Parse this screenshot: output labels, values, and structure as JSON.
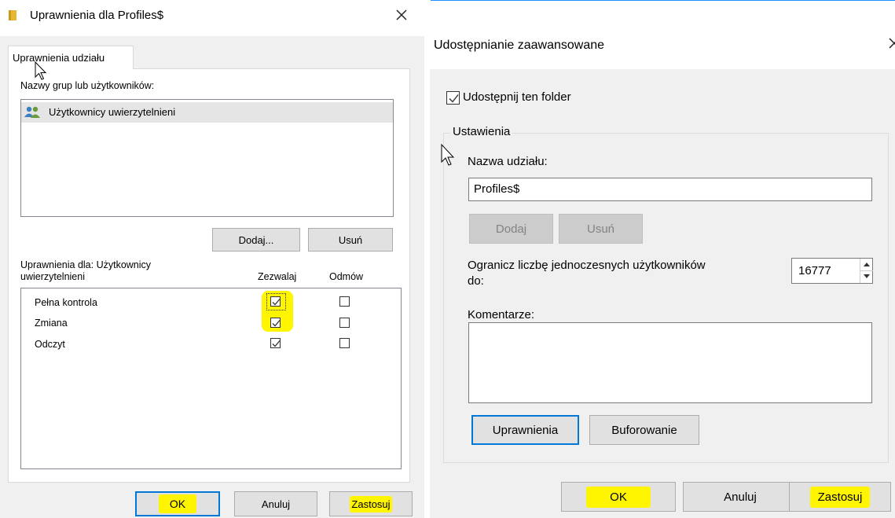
{
  "left": {
    "title": "Uprawnienia dla Profiles$",
    "tab": "Uprawnienia udziału",
    "groups_label": "Nazwy grup lub użytkowników:",
    "users": [
      "Użytkownicy uwierzytelnieni"
    ],
    "add_button": "Dodaj...",
    "remove_button": "Usuń",
    "perms_for_line1": "Uprawnienia dla: Użytkownicy",
    "perms_for_line2": "uwierzytelnieni",
    "allow_col": "Zezwalaj",
    "deny_col": "Odmów",
    "permissions": [
      {
        "name": "Pełna kontrola",
        "allow": true,
        "deny": false
      },
      {
        "name": "Zmiana",
        "allow": true,
        "deny": false
      },
      {
        "name": "Odczyt",
        "allow": true,
        "deny": false
      }
    ],
    "ok_button": "OK",
    "cancel_button": "Anuluj",
    "apply_button": "Zastosuj"
  },
  "right": {
    "title": "Udostępnianie zaawansowane",
    "share_checkbox": "Udostępnij ten folder",
    "share_checked": true,
    "settings_group": "Ustawienia",
    "share_name_label": "Nazwa udziału:",
    "share_name_value": "Profiles$",
    "add_button": "Dodaj",
    "remove_button": "Usuń",
    "limit_label_line1": "Ogranicz liczbę jednoczesnych użytkowników",
    "limit_label_line2": "do:",
    "limit_value": "16777",
    "comments_label": "Komentarze:",
    "comments_value": "",
    "permissions_button": "Uprawnienia",
    "caching_button": "Buforowanie",
    "ok_button": "OK",
    "cancel_button": "Anuluj",
    "apply_button": "Zastosuj"
  },
  "colors": {
    "highlight": "#fff500",
    "accent": "#0078d7",
    "selected_row": "#e5e5e5"
  },
  "icons": {
    "folder": "folder-icon",
    "users": "users-icon",
    "close": "close-icon",
    "cursor": "mouse-cursor-icon"
  }
}
